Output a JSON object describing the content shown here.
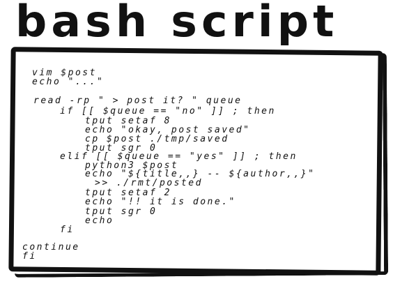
{
  "title": "bash script",
  "lines": [
    "vim $post",
    "echo \"...\"",
    "read -rp \" > post it? \" queue",
    "if [[ $queue == \"no\" ]] ; then",
    "tput setaf 8",
    "echo \"okay, post saved\"",
    "cp $post ./tmp/saved",
    "tput sgr 0",
    "elif [[ $queue == \"yes\" ]] ; then",
    "python3 $post",
    "echo \"${title,,} -- ${author,,}\"",
    ">> ./rmt/posted",
    "tput setaf 2",
    "echo \"!! it is done.\"",
    "tput sgr 0",
    "echo",
    "fi",
    "continue",
    "fi"
  ]
}
